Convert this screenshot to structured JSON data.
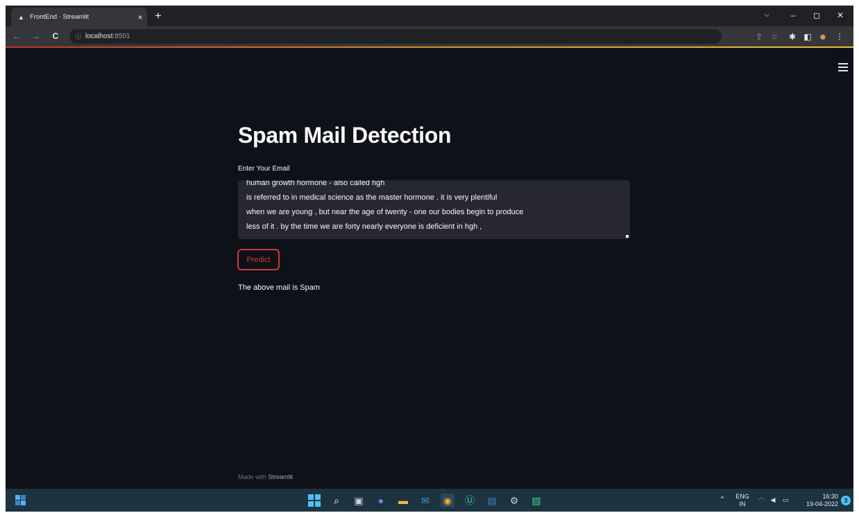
{
  "browser": {
    "tab_title": "FrontEnd · Streamlit",
    "tab_close": "×",
    "new_tab": "+",
    "url_host": "localhost",
    "url_port": ":8501",
    "window_controls": {
      "dropdown": "⌵",
      "minimize": "–",
      "maximize": "◻",
      "close": "✕"
    }
  },
  "app": {
    "title": "Spam Mail Detection",
    "input_label": "Enter Your Email",
    "email_lines": [
      "human growth hormone - also called hgh",
      "is referred to in medical science as the master hormone . it is very plentiful",
      "when we are young , but near the age of twenty - one our bodies begin to produce",
      "less of it . by the time we are forty nearly everyone is deficient in hgh ,"
    ],
    "predict_label": "Predict",
    "result_text": "The above mail is Spam",
    "footer_prefix": "Made with ",
    "footer_brand": "Streamlit"
  },
  "taskbar": {
    "lang_top": "ENG",
    "lang_bottom": "IN",
    "time": "16:30",
    "date": "19-04-2022",
    "notification_count": "3"
  },
  "colors": {
    "background": "#0e1117",
    "input_bg": "#262730",
    "accent_red": "#d0393b",
    "taskbar": "#1d3340"
  }
}
